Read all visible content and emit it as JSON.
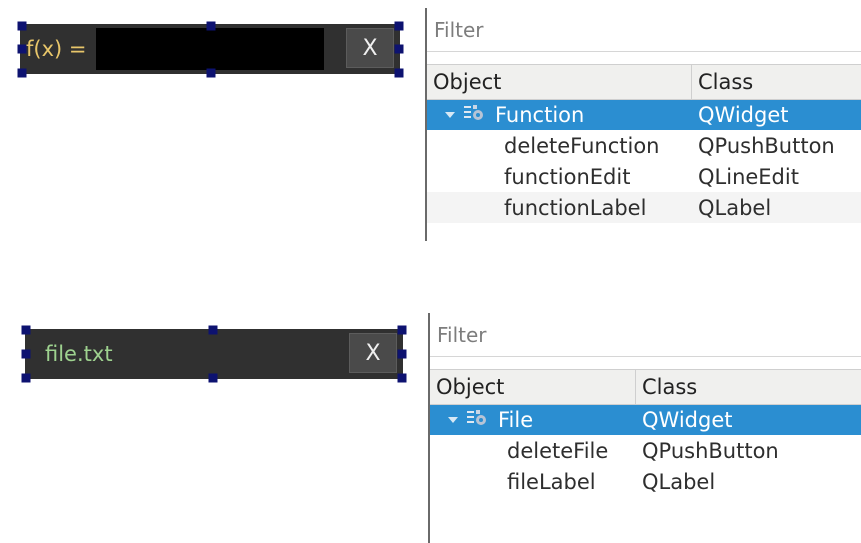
{
  "widgets": [
    {
      "label": "f(x) =",
      "button": "X"
    },
    {
      "label": "file.txt",
      "button": "X"
    }
  ],
  "inspectors": [
    {
      "filter_placeholder": "Filter",
      "columns": {
        "object": "Object",
        "class": "Class"
      },
      "parent": {
        "object": "Function",
        "class": "QWidget"
      },
      "children": [
        {
          "object": "deleteFunction",
          "class": "QPushButton"
        },
        {
          "object": "functionEdit",
          "class": "QLineEdit"
        },
        {
          "object": "functionLabel",
          "class": "QLabel"
        }
      ]
    },
    {
      "filter_placeholder": "Filter",
      "columns": {
        "object": "Object",
        "class": "Class"
      },
      "parent": {
        "object": "File",
        "class": "QWidget"
      },
      "children": [
        {
          "object": "deleteFile",
          "class": "QPushButton"
        },
        {
          "object": "fileLabel",
          "class": "QLabel"
        }
      ]
    }
  ],
  "colors": {
    "selection": "#2b8ed1",
    "handle": "#0d1270",
    "function_label": "#e8c66a",
    "file_label": "#9ed28f"
  }
}
